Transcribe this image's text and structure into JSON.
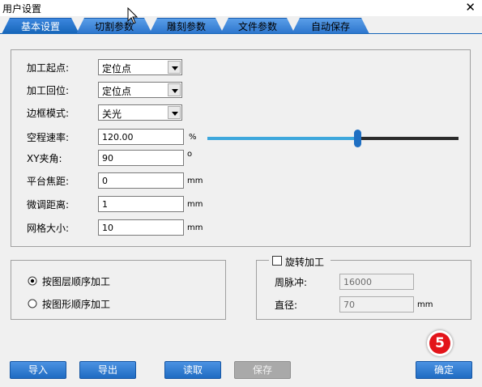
{
  "window": {
    "title": "用户设置",
    "close_glyph": "✕"
  },
  "tabs": [
    {
      "label": "基本设置",
      "active": true
    },
    {
      "label": "切割参数",
      "active": false
    },
    {
      "label": "雕刻参数",
      "active": false
    },
    {
      "label": "文件参数",
      "active": false
    },
    {
      "label": "自动保存",
      "active": false
    }
  ],
  "basic": {
    "start_point": {
      "label": "加工起点:",
      "value": "定位点"
    },
    "return_point": {
      "label": "加工回位:",
      "value": "定位点"
    },
    "frame_mode": {
      "label": "边框模式:",
      "value": "关光"
    },
    "travel_speed": {
      "label": "空程速率:",
      "value": "120.00",
      "unit": "%",
      "slider_fraction": 0.6
    },
    "xy_angle": {
      "label": "XY夹角:",
      "value": "90",
      "unit": "o"
    },
    "table_focus": {
      "label": "平台焦距:",
      "value": "0",
      "unit": "mm"
    },
    "fine_tune": {
      "label": "微调距离:",
      "value": "1",
      "unit": "mm"
    },
    "grid_size": {
      "label": "网格大小:",
      "value": "10",
      "unit": "mm"
    }
  },
  "order": {
    "by_layer": {
      "label": "按图层顺序加工",
      "selected": true
    },
    "by_shape": {
      "label": "按图形顺序加工",
      "selected": false
    }
  },
  "rotate": {
    "enable": {
      "label": "旋转加工",
      "checked": false
    },
    "pulses": {
      "label": "周脉冲:",
      "value": "16000"
    },
    "diameter": {
      "label": "直径:",
      "value": "70",
      "unit": "mm"
    }
  },
  "buttons": {
    "import": "导入",
    "export": "导出",
    "read": "读取",
    "save": "保存",
    "ok": "确定"
  },
  "step_badge": "5",
  "colors": {
    "tab_blue": "#2b74cc",
    "button_blue": "#1f6bc2",
    "slider_fill": "#3ea7dc",
    "badge_red": "#e3141a"
  }
}
